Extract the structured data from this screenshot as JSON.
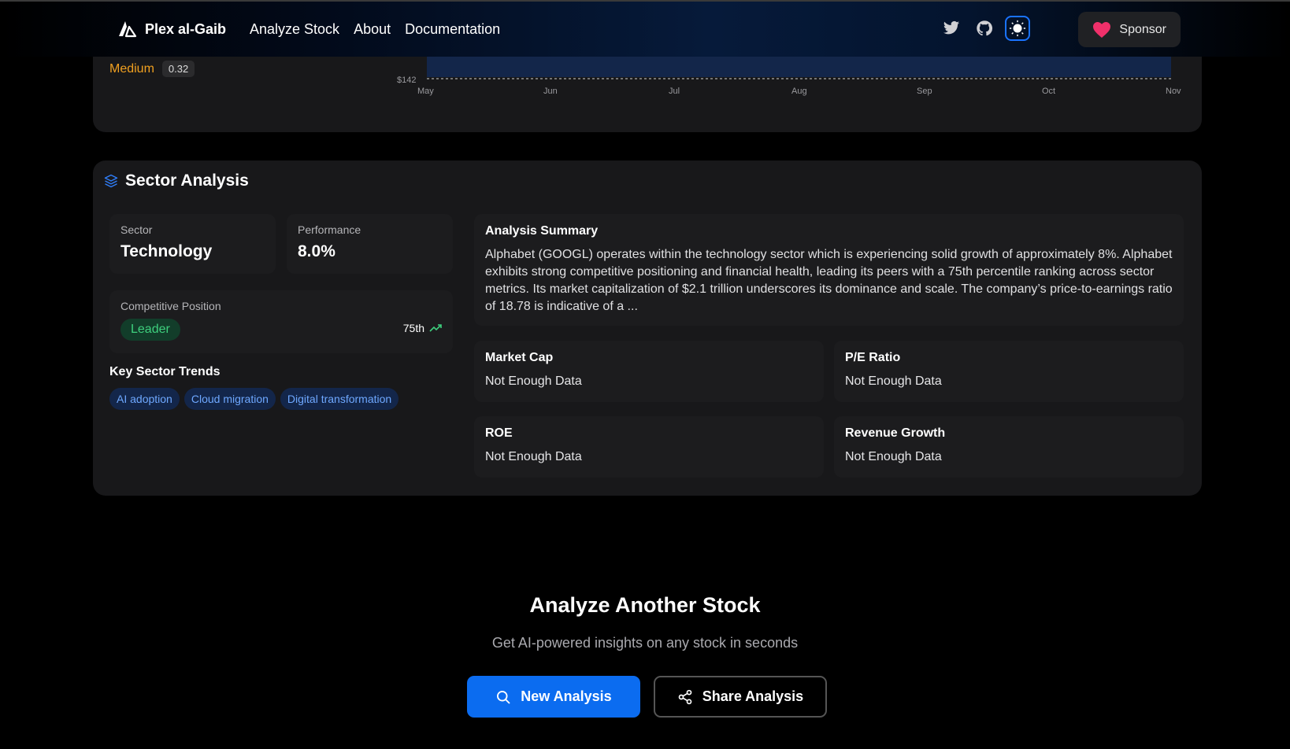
{
  "header": {
    "brand": "Plex al-Gaib",
    "nav": [
      "Analyze Stock",
      "About",
      "Documentation"
    ],
    "sponsor_label": "Sponsor",
    "icons": [
      "twitter-icon",
      "github-icon",
      "theme-toggle-icon"
    ]
  },
  "price_chart": {
    "risk_level": "Medium",
    "risk_value": "0.32",
    "price_label": "$142",
    "months": [
      "May",
      "Jun",
      "Jul",
      "Aug",
      "Sep",
      "Oct",
      "Nov"
    ]
  },
  "sector": {
    "title": "Sector Analysis",
    "sector_label": "Sector",
    "sector_value": "Technology",
    "performance_label": "Performance",
    "performance_value": "8.0%",
    "competitive_label": "Competitive Position",
    "competitive_value": "Leader",
    "percentile": "75th",
    "trends_title": "Key Sector Trends",
    "trends": [
      "AI adoption",
      "Cloud migration",
      "Digital transformation"
    ],
    "summary_title": "Analysis Summary",
    "summary_text": "Alphabet (GOOGL) operates within the technology sector which is experiencing solid growth of approximately 8%. Alphabet exhibits strong competitive positioning and financial health, leading its peers with a 75th percentile ranking across sector metrics. Its market capitalization of $2.1 trillion underscores its dominance and scale. The company’s price-to-earnings ratio of 18.78 is indicative of a ...",
    "metrics": [
      {
        "label": "Market Cap",
        "value": "Not Enough Data"
      },
      {
        "label": "P/E Ratio",
        "value": "Not Enough Data"
      },
      {
        "label": "ROE",
        "value": "Not Enough Data"
      },
      {
        "label": "Revenue Growth",
        "value": "Not Enough Data"
      }
    ]
  },
  "cta": {
    "title": "Analyze Another Stock",
    "subtitle": "Get AI-powered insights on any stock in seconds",
    "new_analysis": "New Analysis",
    "share_analysis": "Share Analysis"
  },
  "colors": {
    "accent": "#0b6cf0",
    "risk_medium": "#f0a020",
    "leader_green": "#3ecf7d",
    "tag_blue": "#6ea8ff"
  }
}
